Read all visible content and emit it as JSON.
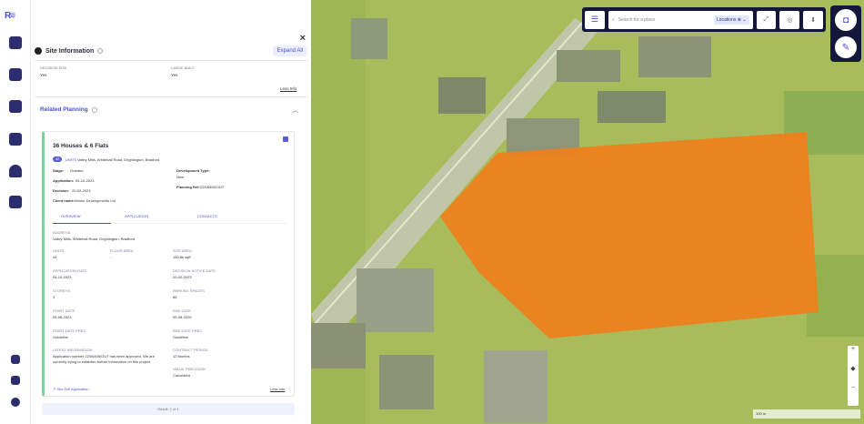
{
  "rail": {
    "logo_main": "R",
    "logo_sup": "≡",
    "icons": [
      "map-icon",
      "document-icon",
      "contact-card-icon",
      "folder-icon",
      "bell-icon",
      "calendar-icon",
      "report-icon",
      "help-icon",
      "logout-icon"
    ]
  },
  "panel": {
    "title": "Site Information",
    "expand_all": "Expand All",
    "close": "×",
    "partial_row": {
      "label_left": "DECISION SIZE",
      "value_left": "Yes",
      "label_right": "LARGE BUILT",
      "value_right": "Yes",
      "less_info": "Less Info"
    },
    "related_planning": "Related Planning",
    "card": {
      "title": "36 Houses & 6 Flats",
      "badge": "42",
      "units_label": "UNITS",
      "units_address": "Valley Mills, Whitehall Road, Drighlington, Bradford",
      "stage_label": "Stage:",
      "stage_value": "Granted",
      "application_label": "Application:",
      "application_value": "04-10-2023",
      "decision_label": "Decision:",
      "decision_value": "20-02-2023",
      "client_label": "Client name:",
      "client_value": "Wrose Developments Ltd",
      "dev_type_label": "Development Type:",
      "dev_type_value": "New",
      "planning_ref_label": "Planning Ref:",
      "planning_ref_value": "22/06405/OUT",
      "tabs": [
        "OVERVIEW",
        "APPLICATION",
        "CONTACTS"
      ],
      "address_label": "ADDRESS",
      "address_value": "Valley Mills, Whitehall Road, Drighlington, Bradford",
      "units_label2": "UNITS",
      "units_value": "44",
      "floor_area_label": "FLOOR AREA",
      "floor_area_value": "-",
      "site_area_label": "SITE AREA",
      "site_area_value": "160.8k sqft",
      "app_date_label": "APPLICATION DATE",
      "app_date_value": "04-10-2023",
      "decision_notice_label": "DECISION NOTICE DATE",
      "decision_notice_value": "20-02-2023",
      "storeys_label": "STOREYS",
      "storeys_value": "3",
      "parking_label": "PARKING SPACES",
      "parking_value": "88",
      "start_date_label": "START DATE",
      "start_date_value": "05-08-2023",
      "end_date_label": "END DATE",
      "end_date_value": "05-08-2026",
      "start_prec_label": "START DATE PREC.",
      "start_prec_value": "Guideline",
      "end_prec_label": "END DATE PREC.",
      "end_prec_value": "Guideline",
      "latest_info_label": "LATEST INFORMATION",
      "latest_info_value": "Application number 22/06405/OUT has been approved. We are currently trying to establish further information on this project.",
      "contract_period_label": "CONTRACT PERIOD",
      "contract_period_value": "12 Months",
      "value_precision_label": "VALUE PRECISION",
      "value_precision_value": "Calculated",
      "see_full": "See Full Application",
      "less_info": "Less Info"
    },
    "result": "Result: 1 of 1"
  },
  "map": {
    "search_placeholder": "Search for a place",
    "locations_label": "Locations",
    "scale": "100 m",
    "overlay_color": "#f07f1c",
    "tint_color": "#a8bc5c"
  }
}
